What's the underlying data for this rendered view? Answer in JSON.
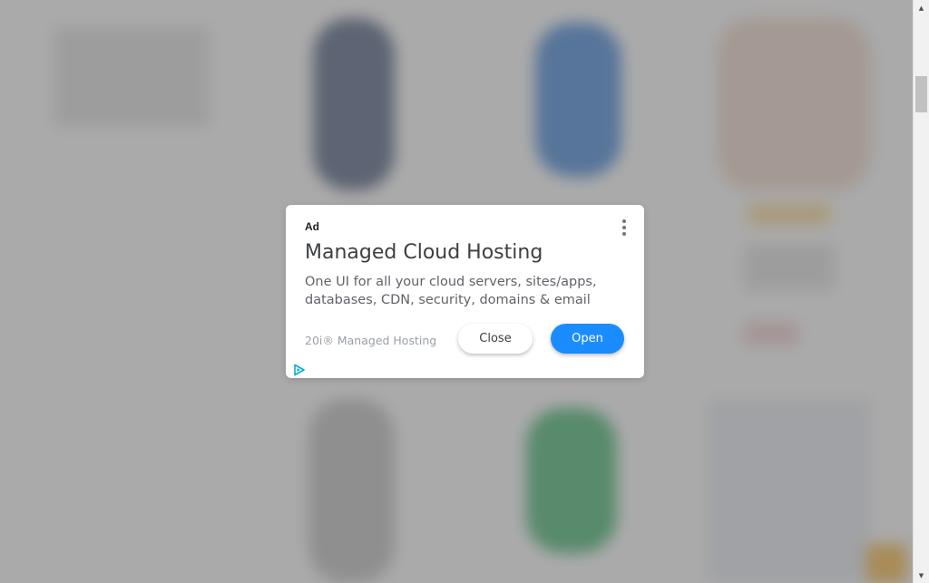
{
  "ad": {
    "label": "Ad",
    "title": "Managed Cloud Hosting",
    "body": "One UI for all your cloud servers, sites/apps, databases, CDN, security, domains & email",
    "advertiser": "20i® Managed Hosting",
    "close_label": "Close",
    "open_label": "Open",
    "menu_icon": "vertical-dots-icon",
    "adchoices_icon": "adchoices-triangle-icon"
  },
  "colors": {
    "open_button": "#1a8cff",
    "overlay": "rgba(110,110,110,0.55)"
  }
}
